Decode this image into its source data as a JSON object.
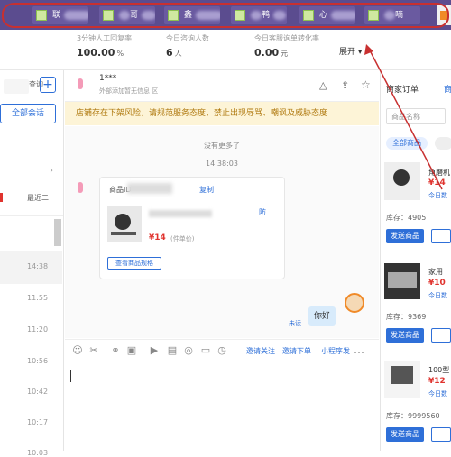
{
  "tabs": [
    {
      "label": "联"
    },
    {
      "label": "哥"
    },
    {
      "label": "鑫"
    },
    {
      "label": "鸭"
    },
    {
      "label": "心"
    },
    {
      "label": "嘀"
    }
  ],
  "stats": [
    {
      "label": "3分钟人工回复率",
      "value": "100.00",
      "unit": "%"
    },
    {
      "label": "今日咨询人数",
      "value": "6",
      "unit": "人"
    },
    {
      "label": "今日客服询单转化率",
      "value": "0.00",
      "unit": "元"
    }
  ],
  "expand_label": "展开",
  "left": {
    "search_label": "查询",
    "add_label": "+",
    "all_sessions": "全部会话",
    "filter_label": "最近二",
    "times": [
      "14:38",
      "11:55",
      "11:20",
      "10:56",
      "10:42",
      "10:17",
      "10:03"
    ]
  },
  "chat": {
    "contact_name": "1***",
    "contact_sub": "外部添加暂无信息 区",
    "notice": "店铺存在下架风险，请规范服务态度，禁止出现辱骂、嘲讽及威胁态度",
    "no_more": "没有更多了",
    "time": "14:38:03",
    "card_header": "商品ID",
    "card_link": "复制",
    "product_tag": "防",
    "price": "¥14",
    "price_unit": "(件单价)",
    "view_btn": "查看商品规格",
    "msg_status": "未读",
    "msg_text": "你好",
    "tool_links": [
      "邀请关注",
      "邀请下单",
      "小程序发"
    ]
  },
  "right": {
    "tabs": [
      "商家订单",
      "商"
    ],
    "search_placeholder": "商品名称",
    "all_products": "全部商品",
    "products": [
      {
        "name": "角磨机",
        "price": "¥14",
        "sub": "今日数",
        "stock": "库存：4905",
        "btn": "发送商品"
      },
      {
        "name": "家用",
        "price": "¥10",
        "sub": "今日数",
        "stock": "库存：9369",
        "btn": "发送商品"
      },
      {
        "name": "100型",
        "price": "¥12",
        "sub": "今日数",
        "stock": "库存：9999560",
        "btn": "发送商品"
      }
    ]
  },
  "colors": {
    "tabbar": "#5b4c8f",
    "accent": "#2e6fd8",
    "notice_bg": "#fdf4d7",
    "price": "#e0332e",
    "annotation": "#c83030"
  }
}
